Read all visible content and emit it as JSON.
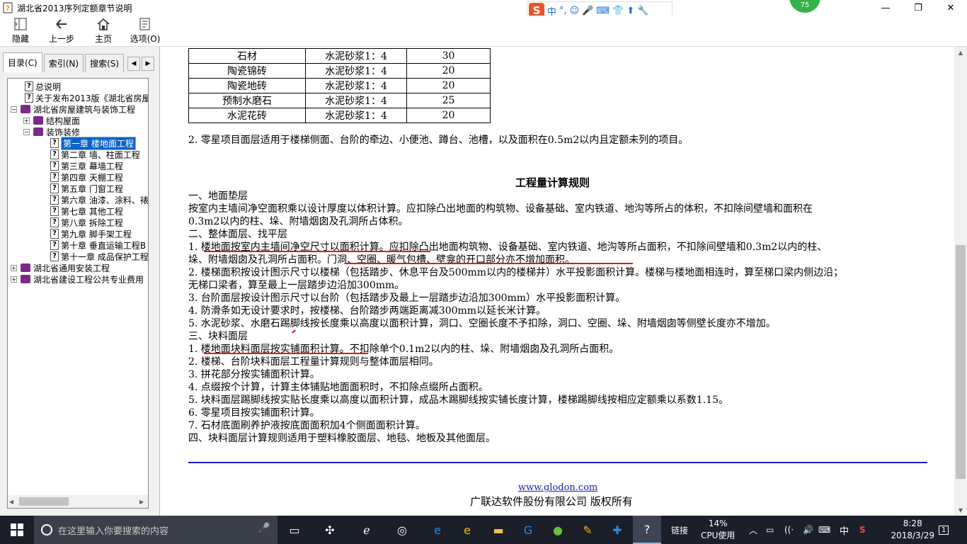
{
  "window": {
    "title": "湖北省2013序列定额章节说明",
    "controls": [
      "—",
      "❐",
      "✕"
    ]
  },
  "ime": {
    "logo": "S",
    "mode": "中",
    "punct": "°,",
    "tools": [
      "☺",
      "🎤",
      "⌨",
      "👕",
      "⬆",
      "🔧"
    ]
  },
  "badge": "75",
  "toolbar": {
    "hide": "隐藏",
    "back": "上一步",
    "home": "主页",
    "options": "选项(O)"
  },
  "tabs": {
    "toc": "目录(C)",
    "index": "索引(N)",
    "search": "搜索(S)"
  },
  "tree": [
    {
      "label": "总说明"
    },
    {
      "label": "关于发布2013版《湖北省房屋"
    },
    {
      "label": "湖北省房屋建筑与装饰工程"
    },
    {
      "label": "结构屋面"
    },
    {
      "label": "装饰装修"
    },
    {
      "label": "第一章 楼地面工程"
    },
    {
      "label": "第二章 墙、柱面工程"
    },
    {
      "label": "第三章 幕墙工程"
    },
    {
      "label": "第四章 天棚工程"
    },
    {
      "label": "第五章 门窗工程"
    },
    {
      "label": "第六章 油漆、涂料、裱"
    },
    {
      "label": "第七章 其他工程"
    },
    {
      "label": "第八章 拆除工程"
    },
    {
      "label": "第九章 脚手架工程"
    },
    {
      "label": "第十章 垂直运输工程B"
    },
    {
      "label": "第十一章 成品保护工程"
    },
    {
      "label": "湖北省通用安装工程"
    },
    {
      "label": "湖北省建设工程公共专业费用"
    }
  ],
  "table": [
    [
      "石材",
      "水泥砂浆1：4",
      "30"
    ],
    [
      "陶瓷锦砖",
      "水泥砂浆1：4",
      "20"
    ],
    [
      "陶瓷地砖",
      "水泥砂浆1：4",
      "20"
    ],
    [
      "预制水磨石",
      "水泥砂浆1：4",
      "25"
    ],
    [
      "水泥花砖",
      "水泥砂浆1：4",
      "20"
    ]
  ],
  "note2": "2. 零星项目面层适用于楼梯侧面、台阶的牵边、小便池、蹲台、池槽，以及面积在0.5m2以内且定额未列的项目。",
  "rules_title": "工程量计算规则",
  "lines": [
    "一、地面垫层",
    "按室内主墙间净空面积乘以设计厚度以体积计算。应扣除凸出地面的构筑物、设备基础、室内铁道、地沟等所占的体积，不扣除间壁墙和面积在",
    "0.3m2以内的柱、垛、附墙烟囱及孔洞所占体积。",
    "二、整体面层、找平层",
    "1. 楼地面按室内主墙间净空尺寸以面积计算。应扣除凸出地面构筑物、设备基础、室内铁道、地沟等所占面积，不扣除间壁墙和0.3m2以内的柱、",
    "垛、附墙烟囱及孔洞所占面积。门洞、空圈、暖气包槽、壁龛的开口部分亦不增加面积。",
    "2. 楼梯面积按设计图示尺寸以楼梯（包括踏步、休息平台及500mm以内的楼梯井）水平投影面积计算。楼梯与楼地面相连时，算至梯口梁内侧边沿；",
    "无梯口梁者，算至最上一层踏步边沿加300mm。",
    "3. 台阶面层按设计图示尺寸以台阶（包括踏步及最上一层踏步边沿加300mm）水平投影面积计算。",
    "4. 防滑条如无设计要求时，按楼梯、台阶踏步两端距离减300mm以延长米计算。",
    "5. 水泥砂浆、水磨石踢脚线按长度乘以高度以面积计算，洞口、空圈长度不予扣除，洞口、空圈、垛、附墙烟囱等侧壁长度亦不增加。",
    "三、块料面层",
    "1. 楼地面块料面层按实铺面积计算。不扣除单个0.1m2以内的柱、垛、附墙烟囱及孔洞所占面积。",
    "2. 楼梯、台阶块料面层工程量计算规则与整体面层相同。",
    "3. 拼花部分按实铺面积计算。",
    "4. 点缀按个计算，计算主体铺贴地面面积时，不扣除点缀所占面积。",
    "5. 块料面层踢脚线按实贴长度乘以高度以面积计算，成品木踢脚线按实铺长度计算，楼梯踢脚线按相应定额乘以系数1.15。",
    "6. 零星项目按实铺面积计算。",
    "7. 石材底面刷养护液按底面面积加4个侧面面积计算。",
    "四、块料面层计算规则适用于塑料橡胶面层、地毯、地板及其他面层。"
  ],
  "footer": {
    "link": "www.glodon.com",
    "copyright": "广联达软件股份有限公司 版权所有"
  },
  "taskbar": {
    "search_placeholder": "在这里输入你要搜索的内容",
    "link_label": "链接",
    "cpu_percent": "14%",
    "cpu_label": "CPU使用",
    "ime": "中",
    "time": "8:28",
    "date": "2018/3/29",
    "notif": "1"
  }
}
